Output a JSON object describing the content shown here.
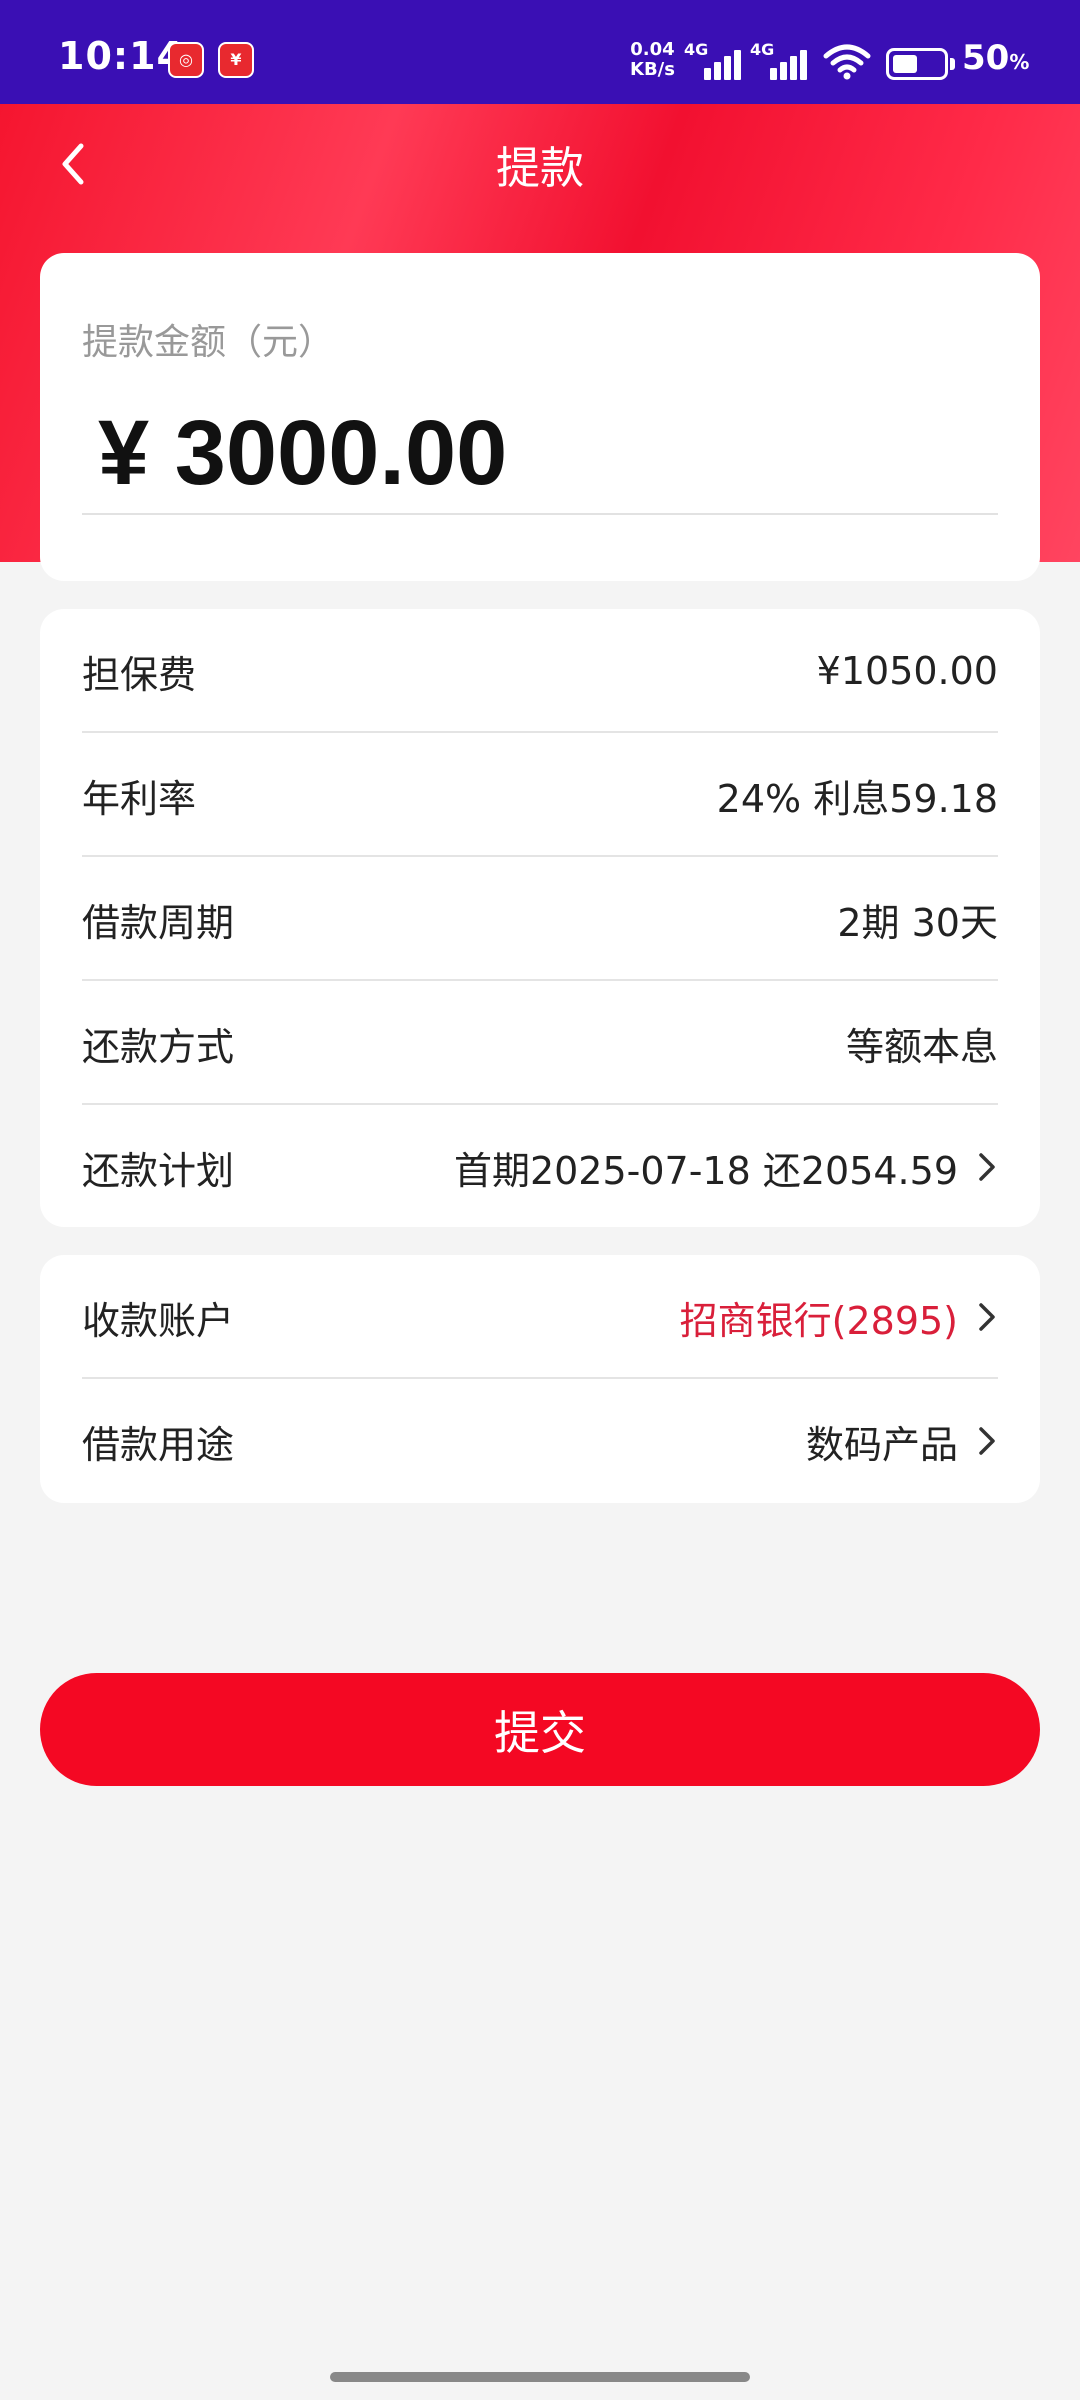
{
  "status_bar": {
    "time": "10:14",
    "net_speed_value": "0.04",
    "net_speed_unit": "KB/s",
    "signal_1_label": "4G",
    "signal_2_label": "4G",
    "battery_level": 0.5,
    "battery_percent": "50",
    "battery_percent_sign": "%",
    "app_icons": [
      "china-merchants-bank-icon",
      "finance-app-icon"
    ]
  },
  "header": {
    "title": "提款",
    "back_icon": "chevron-left-icon"
  },
  "amount": {
    "label": "提款金额（元）",
    "value": "¥ 3000.00"
  },
  "details": [
    {
      "label": "担保费",
      "value": "¥1050.00",
      "chevron": false
    },
    {
      "label": "年利率",
      "value": "24% 利息59.18",
      "chevron": false
    },
    {
      "label": "借款周期",
      "value": "2期 30天",
      "chevron": false
    },
    {
      "label": "还款方式",
      "value": "等额本息",
      "chevron": false
    },
    {
      "label": "还款计划",
      "value": "首期2025-07-18 还2054.59",
      "chevron": true
    }
  ],
  "payment": [
    {
      "label": "收款账户",
      "value": "招商银行(2895)",
      "chevron": true,
      "highlight": true
    },
    {
      "label": "借款用途",
      "value": "数码产品",
      "chevron": true,
      "highlight": false
    }
  ],
  "submit_label": "提交",
  "colors": {
    "status_bar": "#3a0fb4",
    "header_red": "#f5152f",
    "button_red": "#f40823",
    "account_red": "#d91f3a",
    "background": "#f4f4f4"
  }
}
